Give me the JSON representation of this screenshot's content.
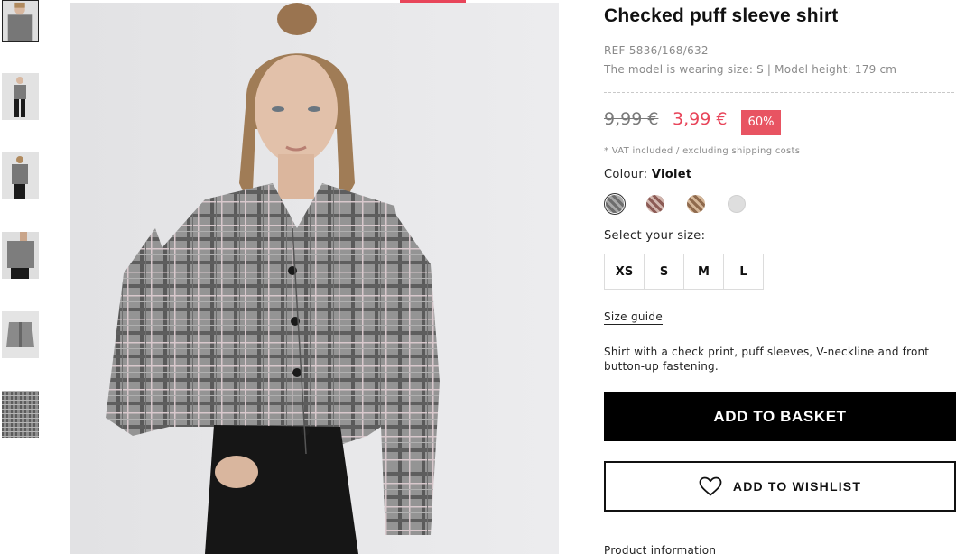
{
  "thumbnails": [
    {
      "name": "thumb-front-closeup",
      "active": true
    },
    {
      "name": "thumb-full-body"
    },
    {
      "name": "thumb-side"
    },
    {
      "name": "thumb-back-detail"
    },
    {
      "name": "thumb-flat-lay"
    },
    {
      "name": "thumb-fabric-detail"
    }
  ],
  "product": {
    "title": "Checked puff sleeve shirt",
    "ref": "REF 5836/168/632",
    "model_info": "The model is wearing size: S | Model height: 179 cm",
    "old_price": "9,99 €",
    "new_price": "3,99 €",
    "discount": "60%",
    "vat_note": "* VAT included / excluding shipping costs",
    "colour_label": "Colour:",
    "colour_value": "Violet",
    "swatches": [
      {
        "name": "grey-check",
        "color": "#8f8f8f",
        "selected": true
      },
      {
        "name": "red-check",
        "color": "#b98c84"
      },
      {
        "name": "brown-check",
        "color": "#b99a78"
      },
      {
        "name": "light-grey",
        "color": "#dedede"
      }
    ],
    "size_label": "Select your size:",
    "sizes": [
      "XS",
      "S",
      "M",
      "L"
    ],
    "size_guide": "Size guide",
    "description": "Shirt with a check print, puff sleeves, V-neckline and front button-up fastening.",
    "add_to_basket": "ADD TO BASKET",
    "add_to_wishlist": "ADD TO WISHLIST",
    "product_information": "Product information"
  },
  "colors": {
    "sale": "#e8455a",
    "badge": "#e85462",
    "basket_bg": "#000000"
  }
}
